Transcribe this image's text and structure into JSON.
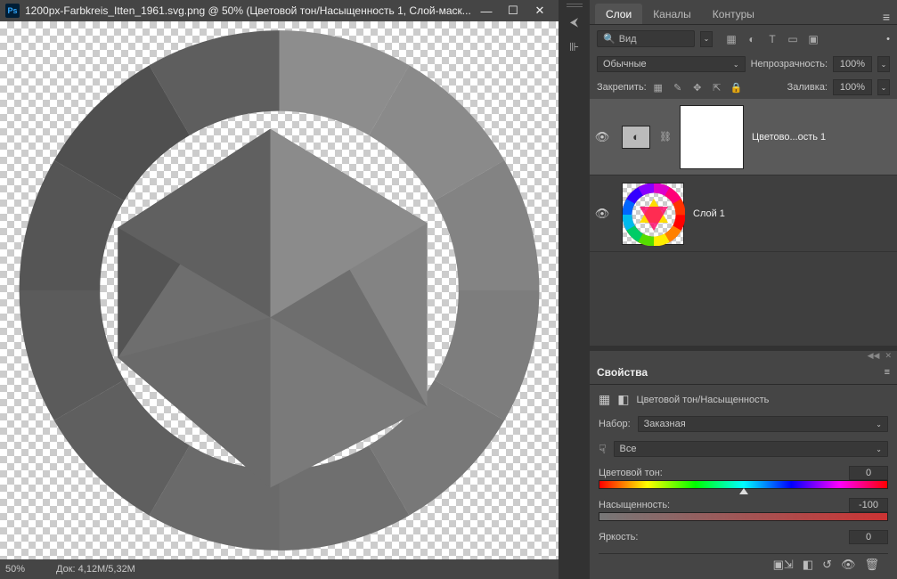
{
  "window": {
    "title": "1200px-Farbkreis_Itten_1961.svg.png @ 50% (Цветовой тон/Насыщенность 1, Слой-маск...",
    "min": "—",
    "max": "☐",
    "close": "✕"
  },
  "status": {
    "zoom": "50%",
    "doc": "Док: 4,12M/5,32M"
  },
  "midbar": {
    "collapse_icon": "⮜",
    "ruler_icon": "⊪"
  },
  "tabs": {
    "layers": "Слои",
    "channels": "Каналы",
    "paths": "Контуры",
    "menu": "≡"
  },
  "search": {
    "icon": "🔍",
    "label": "Вид"
  },
  "filters": {
    "img": "▦",
    "adj": "◐",
    "text": "T",
    "shape": "▭",
    "smart": "▣",
    "more": "•"
  },
  "blend": {
    "mode": "Обычные",
    "opacity_label": "Непрозрачность:",
    "opacity_value": "100%"
  },
  "lock": {
    "label": "Закрепить:",
    "fill_label": "Заливка:",
    "fill_value": "100%",
    "i1": "▦",
    "i2": "✎",
    "i3": "✥",
    "i4": "⇱",
    "i5": "🔒"
  },
  "layers": {
    "adj": {
      "name": "Цветово...ость 1",
      "link": "⛓"
    },
    "l1": {
      "name": "Слой 1"
    }
  },
  "props": {
    "title": "Свойства",
    "type_icon1": "▦",
    "type_icon2": "◧",
    "type_label": "Цветовой тон/Насыщенность",
    "preset_label": "Набор:",
    "preset_value": "Заказная",
    "finger_icon": "☟",
    "range_value": "Все",
    "hue_label": "Цветовой тон:",
    "hue_value": "0",
    "sat_label": "Насыщенность:",
    "sat_value": "-100",
    "light_label": "Яркость:",
    "light_value": "0",
    "actions": {
      "clip": "▣⇲",
      "prev": "◧",
      "reset": "↺",
      "vis": "👁",
      "del": "🗑"
    }
  }
}
